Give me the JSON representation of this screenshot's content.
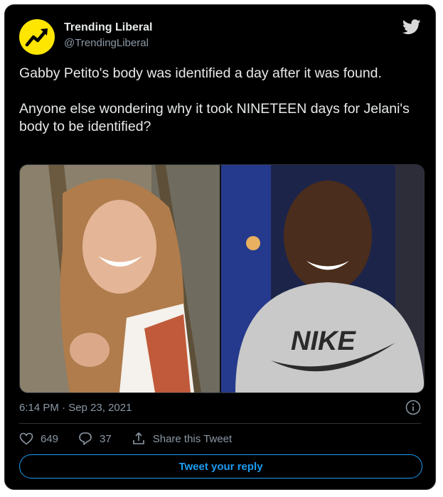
{
  "tweet": {
    "author_name": "Trending Liberal",
    "author_handle": "@TrendingLiberal",
    "paragraphs": [
      "Gabby Petito's body was identified a day after it was found.",
      "Anyone else wondering why it took NINETEEN days for Jelani's body to be identified?"
    ],
    "timestamp": "6:14 PM · Sep 23, 2021",
    "media": {
      "left_shirt_text": "",
      "right_shirt_text": "NIKE"
    }
  },
  "actions": {
    "like_count": "649",
    "reply_count": "37",
    "share_label": "Share this Tweet"
  },
  "reply_button": "Tweet your reply",
  "colors": {
    "background": "#000000",
    "accent": "#1d9bf0",
    "muted": "#8b98a5",
    "avatar_bg": "#ffe600"
  },
  "icons": [
    "trending-arrow-icon",
    "twitter-bird-icon",
    "info-icon",
    "heart-icon",
    "reply-icon",
    "share-icon"
  ]
}
